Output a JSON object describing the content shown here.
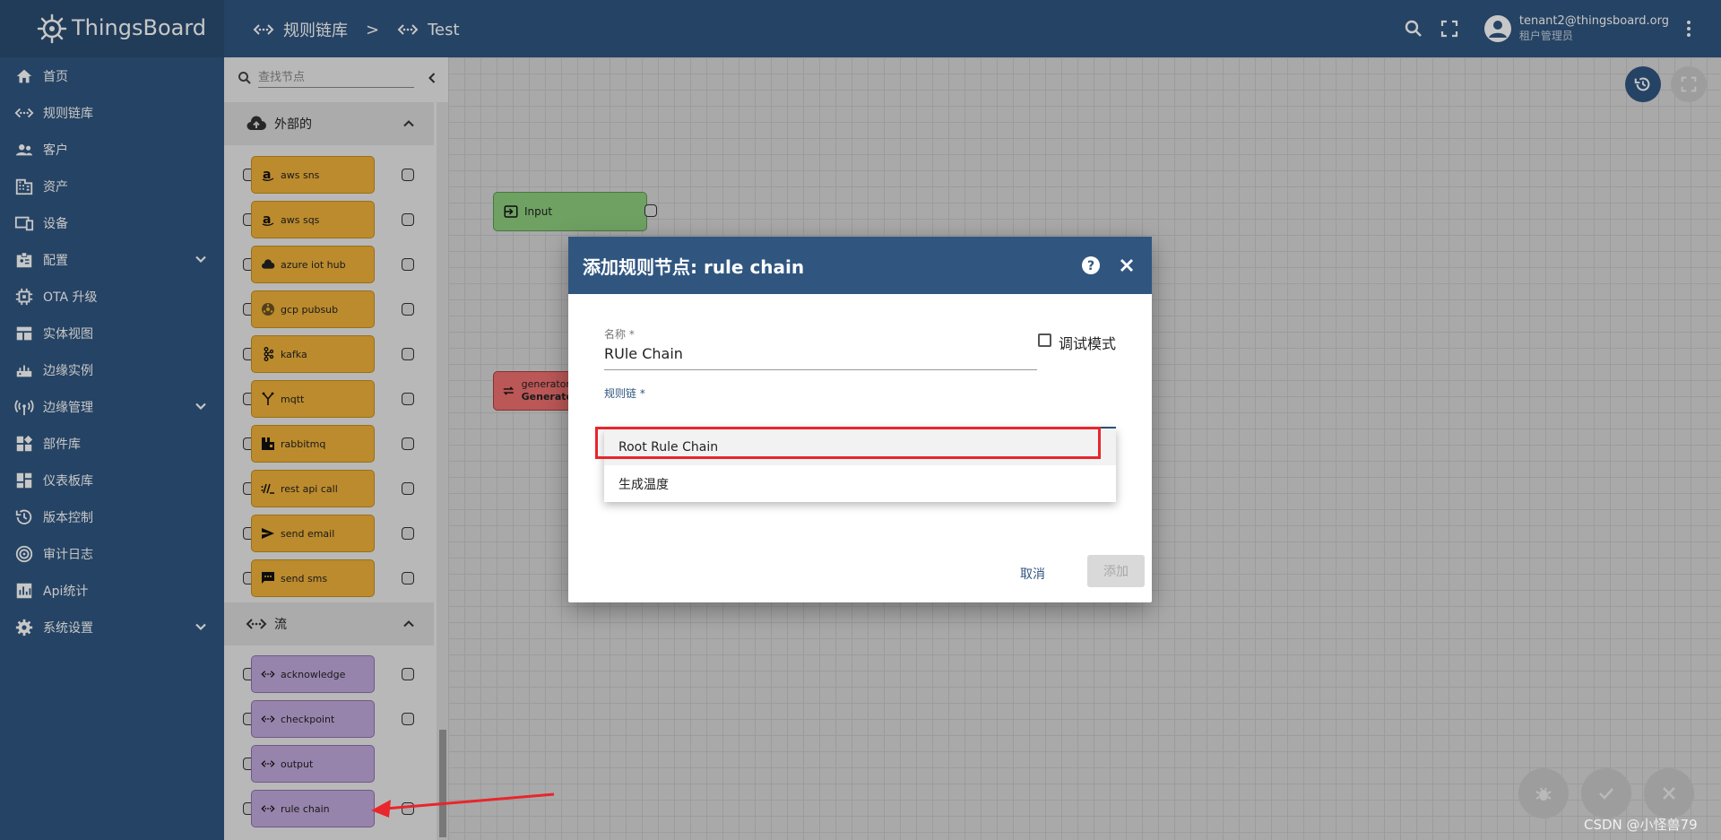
{
  "app": {
    "name": "ThingsBoard"
  },
  "header": {
    "crumbs": [
      "规则链库",
      "Test"
    ],
    "crumb_separator": ">",
    "user_email": "tenant2@thingsboard.org",
    "user_role": "租户管理员"
  },
  "sidebar": {
    "items": [
      {
        "label": "首页",
        "icon": "home-icon"
      },
      {
        "label": "规则链库",
        "icon": "rule-chain-icon"
      },
      {
        "label": "客户",
        "icon": "customers-icon"
      },
      {
        "label": "资产",
        "icon": "assets-icon"
      },
      {
        "label": "设备",
        "icon": "devices-icon"
      },
      {
        "label": "配置",
        "icon": "profiles-icon",
        "expandable": true
      },
      {
        "label": "OTA 升级",
        "icon": "ota-icon"
      },
      {
        "label": "实体视图",
        "icon": "entity-view-icon"
      },
      {
        "label": "边缘实例",
        "icon": "edge-icon"
      },
      {
        "label": "边缘管理",
        "icon": "edge-management-icon",
        "expandable": true
      },
      {
        "label": "部件库",
        "icon": "widgets-icon"
      },
      {
        "label": "仪表板库",
        "icon": "dashboards-icon"
      },
      {
        "label": "版本控制",
        "icon": "version-control-icon"
      },
      {
        "label": "审计日志",
        "icon": "audit-log-icon"
      },
      {
        "label": "Api统计",
        "icon": "api-usage-icon"
      },
      {
        "label": "系统设置",
        "icon": "settings-icon",
        "expandable": true
      }
    ]
  },
  "library": {
    "search_placeholder": "查找节点",
    "categories": [
      {
        "title": "外部的",
        "nodes": [
          "aws sns",
          "aws sqs",
          "azure iot hub",
          "gcp pubsub",
          "kafka",
          "mqtt",
          "rabbitmq",
          "rest api call",
          "send email",
          "send sms"
        ]
      },
      {
        "title": "流",
        "nodes": [
          "acknowledge",
          "checkpoint",
          "output",
          "rule chain"
        ]
      }
    ]
  },
  "canvas": {
    "input_node": "Input",
    "generator_node_type": "generator",
    "generator_node_name": "Generate"
  },
  "dialog": {
    "title": "添加规则节点: rule chain",
    "name_label": "名称 *",
    "name_value": "RUle Chain",
    "debug_label": "调试模式",
    "chain_label": "规则链 *",
    "options": [
      "Root Rule Chain",
      "生成温度"
    ],
    "cancel_label": "取消",
    "add_label": "添加"
  },
  "colors": {
    "primary": "#305680",
    "external_node": "#f1b33a",
    "flow_node": "#c2a9dd",
    "input_node": "#8fcf7f",
    "generator_node": "#f07070",
    "highlight_red": "#e8262b"
  },
  "watermark": "CSDN @小怪兽79"
}
